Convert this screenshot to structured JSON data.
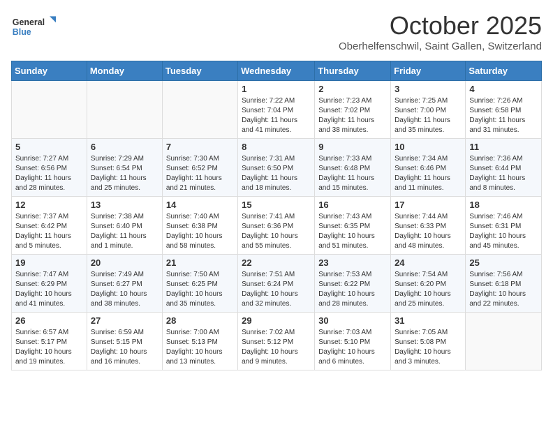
{
  "header": {
    "logo_general": "General",
    "logo_blue": "Blue",
    "month_title": "October 2025",
    "location": "Oberhelfenschwil, Saint Gallen, Switzerland"
  },
  "weekdays": [
    "Sunday",
    "Monday",
    "Tuesday",
    "Wednesday",
    "Thursday",
    "Friday",
    "Saturday"
  ],
  "weeks": [
    [
      {
        "day": "",
        "info": ""
      },
      {
        "day": "",
        "info": ""
      },
      {
        "day": "",
        "info": ""
      },
      {
        "day": "1",
        "info": "Sunrise: 7:22 AM\nSunset: 7:04 PM\nDaylight: 11 hours and 41 minutes."
      },
      {
        "day": "2",
        "info": "Sunrise: 7:23 AM\nSunset: 7:02 PM\nDaylight: 11 hours and 38 minutes."
      },
      {
        "day": "3",
        "info": "Sunrise: 7:25 AM\nSunset: 7:00 PM\nDaylight: 11 hours and 35 minutes."
      },
      {
        "day": "4",
        "info": "Sunrise: 7:26 AM\nSunset: 6:58 PM\nDaylight: 11 hours and 31 minutes."
      }
    ],
    [
      {
        "day": "5",
        "info": "Sunrise: 7:27 AM\nSunset: 6:56 PM\nDaylight: 11 hours and 28 minutes."
      },
      {
        "day": "6",
        "info": "Sunrise: 7:29 AM\nSunset: 6:54 PM\nDaylight: 11 hours and 25 minutes."
      },
      {
        "day": "7",
        "info": "Sunrise: 7:30 AM\nSunset: 6:52 PM\nDaylight: 11 hours and 21 minutes."
      },
      {
        "day": "8",
        "info": "Sunrise: 7:31 AM\nSunset: 6:50 PM\nDaylight: 11 hours and 18 minutes."
      },
      {
        "day": "9",
        "info": "Sunrise: 7:33 AM\nSunset: 6:48 PM\nDaylight: 11 hours and 15 minutes."
      },
      {
        "day": "10",
        "info": "Sunrise: 7:34 AM\nSunset: 6:46 PM\nDaylight: 11 hours and 11 minutes."
      },
      {
        "day": "11",
        "info": "Sunrise: 7:36 AM\nSunset: 6:44 PM\nDaylight: 11 hours and 8 minutes."
      }
    ],
    [
      {
        "day": "12",
        "info": "Sunrise: 7:37 AM\nSunset: 6:42 PM\nDaylight: 11 hours and 5 minutes."
      },
      {
        "day": "13",
        "info": "Sunrise: 7:38 AM\nSunset: 6:40 PM\nDaylight: 11 hours and 1 minute."
      },
      {
        "day": "14",
        "info": "Sunrise: 7:40 AM\nSunset: 6:38 PM\nDaylight: 10 hours and 58 minutes."
      },
      {
        "day": "15",
        "info": "Sunrise: 7:41 AM\nSunset: 6:36 PM\nDaylight: 10 hours and 55 minutes."
      },
      {
        "day": "16",
        "info": "Sunrise: 7:43 AM\nSunset: 6:35 PM\nDaylight: 10 hours and 51 minutes."
      },
      {
        "day": "17",
        "info": "Sunrise: 7:44 AM\nSunset: 6:33 PM\nDaylight: 10 hours and 48 minutes."
      },
      {
        "day": "18",
        "info": "Sunrise: 7:46 AM\nSunset: 6:31 PM\nDaylight: 10 hours and 45 minutes."
      }
    ],
    [
      {
        "day": "19",
        "info": "Sunrise: 7:47 AM\nSunset: 6:29 PM\nDaylight: 10 hours and 41 minutes."
      },
      {
        "day": "20",
        "info": "Sunrise: 7:49 AM\nSunset: 6:27 PM\nDaylight: 10 hours and 38 minutes."
      },
      {
        "day": "21",
        "info": "Sunrise: 7:50 AM\nSunset: 6:25 PM\nDaylight: 10 hours and 35 minutes."
      },
      {
        "day": "22",
        "info": "Sunrise: 7:51 AM\nSunset: 6:24 PM\nDaylight: 10 hours and 32 minutes."
      },
      {
        "day": "23",
        "info": "Sunrise: 7:53 AM\nSunset: 6:22 PM\nDaylight: 10 hours and 28 minutes."
      },
      {
        "day": "24",
        "info": "Sunrise: 7:54 AM\nSunset: 6:20 PM\nDaylight: 10 hours and 25 minutes."
      },
      {
        "day": "25",
        "info": "Sunrise: 7:56 AM\nSunset: 6:18 PM\nDaylight: 10 hours and 22 minutes."
      }
    ],
    [
      {
        "day": "26",
        "info": "Sunrise: 6:57 AM\nSunset: 5:17 PM\nDaylight: 10 hours and 19 minutes."
      },
      {
        "day": "27",
        "info": "Sunrise: 6:59 AM\nSunset: 5:15 PM\nDaylight: 10 hours and 16 minutes."
      },
      {
        "day": "28",
        "info": "Sunrise: 7:00 AM\nSunset: 5:13 PM\nDaylight: 10 hours and 13 minutes."
      },
      {
        "day": "29",
        "info": "Sunrise: 7:02 AM\nSunset: 5:12 PM\nDaylight: 10 hours and 9 minutes."
      },
      {
        "day": "30",
        "info": "Sunrise: 7:03 AM\nSunset: 5:10 PM\nDaylight: 10 hours and 6 minutes."
      },
      {
        "day": "31",
        "info": "Sunrise: 7:05 AM\nSunset: 5:08 PM\nDaylight: 10 hours and 3 minutes."
      },
      {
        "day": "",
        "info": ""
      }
    ]
  ]
}
